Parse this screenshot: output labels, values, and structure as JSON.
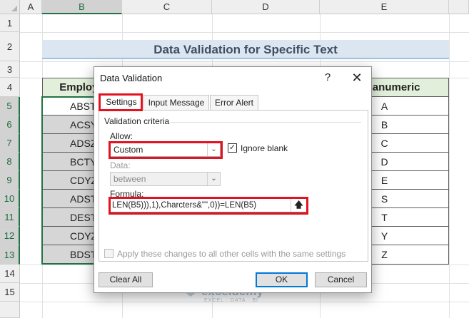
{
  "sheet": {
    "columns": [
      "A",
      "B",
      "C",
      "D",
      "E"
    ],
    "rows": [
      "1",
      "2",
      "3",
      "4",
      "5",
      "6",
      "7",
      "8",
      "9",
      "10",
      "11",
      "12",
      "13",
      "14",
      "15"
    ],
    "title": "Data Validation for Specific Text",
    "header_b": "Employe",
    "header_e": "Alphanumeric",
    "col_b_values": [
      "ABST",
      "ACSY",
      "ADSZ",
      "BCTY",
      "CDYZ",
      "ADST",
      "DEST",
      "CDYZ",
      "BDST"
    ],
    "col_e_values": [
      "A",
      "B",
      "C",
      "D",
      "E",
      "S",
      "T",
      "Y",
      "Z"
    ]
  },
  "dialog": {
    "title": "Data Validation",
    "help": "?",
    "close": "✕",
    "tabs": [
      "Settings",
      "Input Message",
      "Error Alert"
    ],
    "criteria_label": "Validation criteria",
    "allow_label": "Allow:",
    "allow_value": "Custom",
    "ignore_blank_label": "Ignore blank",
    "ignore_blank_checked": "✓",
    "data_label": "Data:",
    "data_value": "between",
    "formula_label": "Formula:",
    "formula_value": "LEN(B5))),1),Charcters&\"\",0))=LEN(B5)",
    "apply_label": "Apply these changes to all other cells with the same settings",
    "clear_all": "Clear All",
    "ok": "OK",
    "cancel": "Cancel"
  },
  "watermark": {
    "name": "exceldemy",
    "tagline": "EXCEL · DATA · BI"
  },
  "colors": {
    "highlight": "#e2131f",
    "table_header": "#e2efda",
    "title_fill": "#dbe6f1",
    "selection": "#217346"
  }
}
